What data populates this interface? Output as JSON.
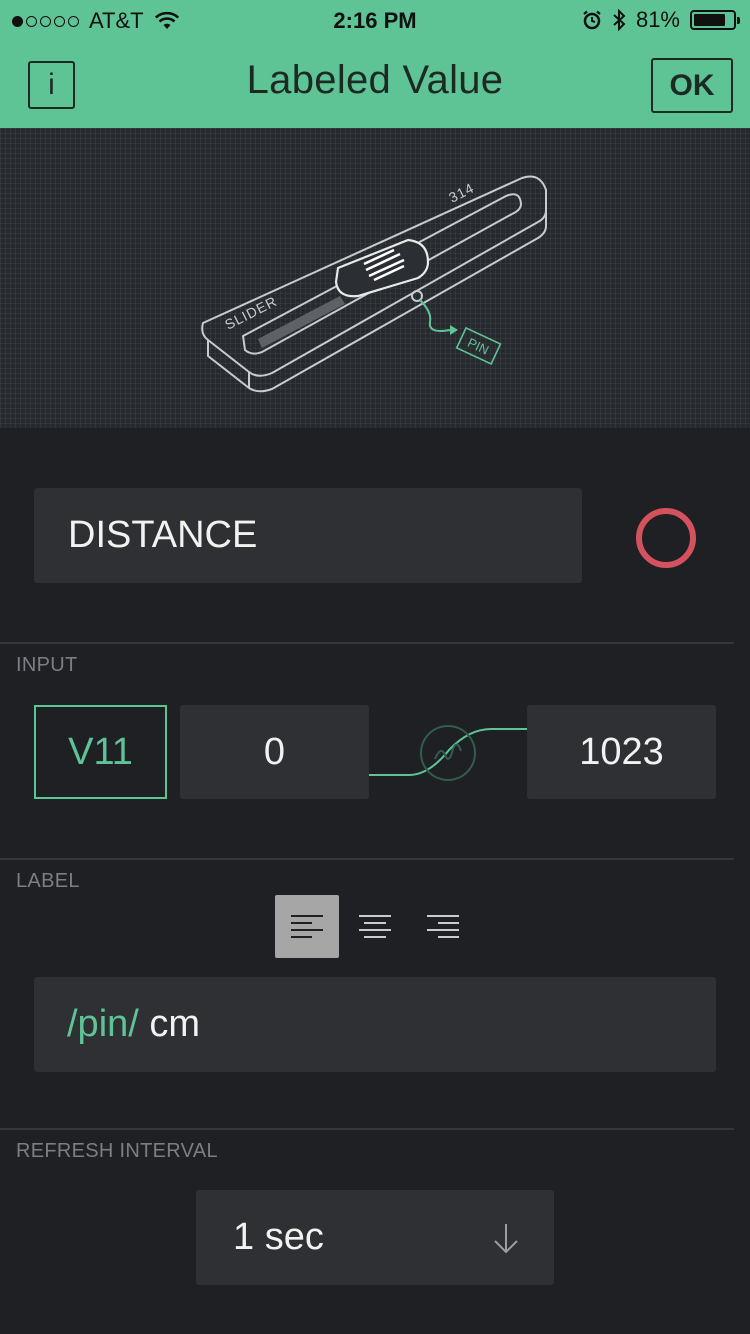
{
  "status_bar": {
    "carrier": "AT&T",
    "time": "2:16 PM",
    "battery": "81%",
    "battery_level": 0.81,
    "signal_bars_filled": 1,
    "signal_bars_total": 5
  },
  "header": {
    "title": "Labeled Value",
    "info_label": "i",
    "ok_label": "OK",
    "background_color": "#5ec496"
  },
  "illustration": {
    "device_label": "SLIDER",
    "device_value": "314",
    "pin_tag": "PIN"
  },
  "widget": {
    "name": "DISTANCE",
    "color": "#d4525e"
  },
  "input": {
    "section_label": "INPUT",
    "pin": "V11",
    "min": "0",
    "max": "1023"
  },
  "label": {
    "section_label": "LABEL",
    "alignment": "left",
    "value_pin": "/pin/",
    "value_suffix": " cm"
  },
  "refresh": {
    "section_label": "REFRESH INTERVAL",
    "value": "1 sec"
  },
  "colors": {
    "accent": "#5ec496",
    "background": "#1f2024",
    "field": "#2f3034",
    "muted_text": "#7b7e84"
  }
}
